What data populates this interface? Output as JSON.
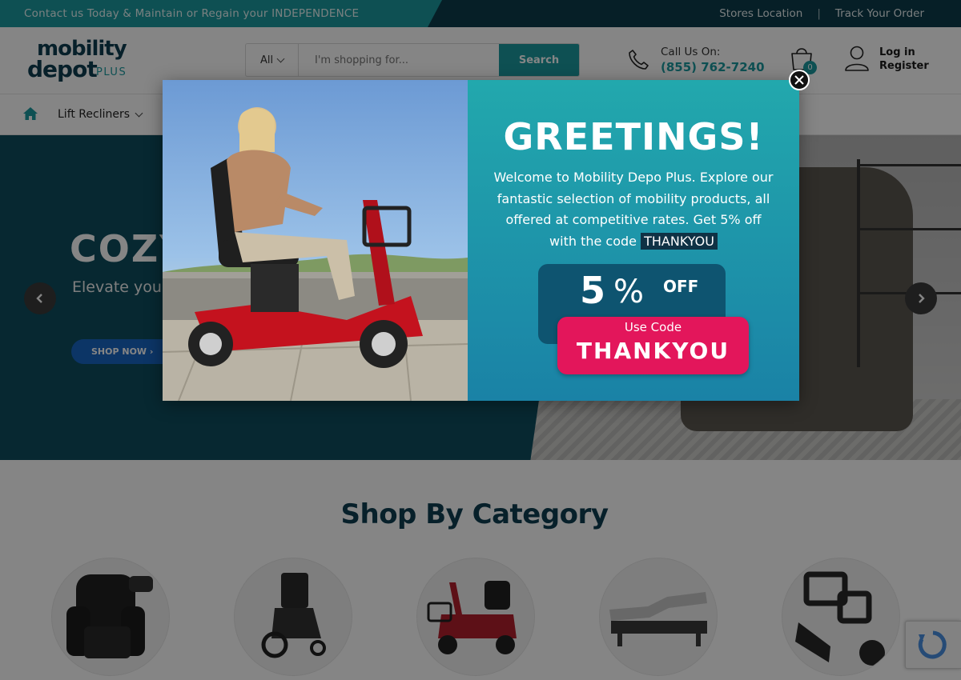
{
  "topbar": {
    "promo": "Contact us Today & Maintain or Regain your INDEPENDENCE",
    "links": [
      "Stores Location",
      "Track Your Order"
    ],
    "separator": "|"
  },
  "header": {
    "logo": {
      "line1": "mobility",
      "line2": "depot",
      "line3": "PLUS"
    },
    "search": {
      "category": "All",
      "placeholder": "I'm shopping for...",
      "button": "Search"
    },
    "call": {
      "label": "Call Us On:",
      "number": "(855) 762-7240"
    },
    "cart_count": "0",
    "account": {
      "login": "Log in",
      "register": "Register"
    }
  },
  "nav": {
    "items": [
      {
        "label": "Lift Recliners"
      }
    ]
  },
  "hero": {
    "title": "COZY",
    "subtitle": "Elevate you recliners!",
    "button": "SHOP NOW"
  },
  "categories": {
    "title": "Shop By Category",
    "icons": [
      "recliner-image",
      "wheelchair-image",
      "scooter-image",
      "adjustable-bed-image",
      "accessory-image"
    ]
  },
  "popup": {
    "heading": "GREETINGS!",
    "message_pre": "Welcome to Mobility Depo Plus. Explore our fantastic selection of mobility products, all offered at competitive rates. Get 5% off with the code",
    "inline_code": "THANKYOU",
    "discount_number": "5",
    "discount_percent": "%",
    "discount_off": "OFF",
    "use_code_label": "Use Code",
    "code": "THANKYOU"
  },
  "colors": {
    "teal": "#1b9aa0",
    "navy": "#0f3e52",
    "popup_pink": "#e3165b",
    "hero_button_blue": "#1766c4"
  }
}
